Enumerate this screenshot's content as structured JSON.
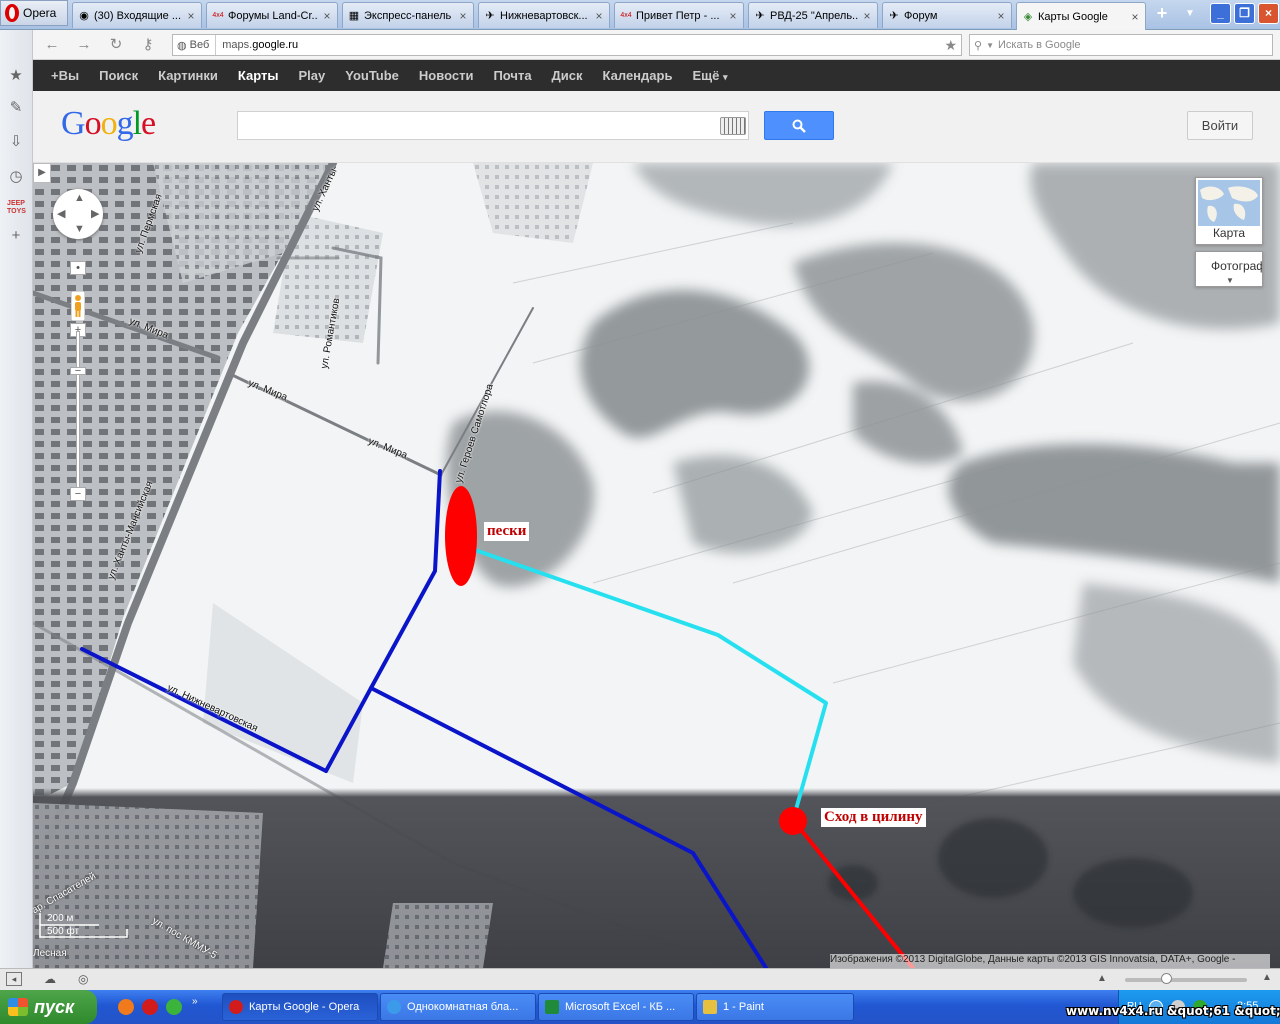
{
  "browser": {
    "menu_label": "Opera",
    "tabs": [
      {
        "label": "(30) Входящие ...",
        "icon": "gmail-icon"
      },
      {
        "label": "Форумы Land-Cr...",
        "icon": "forum-icon"
      },
      {
        "label": "Экспресс-панель",
        "icon": "speed-dial-icon"
      },
      {
        "label": "Нижневартовск...",
        "icon": "forum-icon"
      },
      {
        "label": "Привет Петр - ...",
        "icon": "forum-icon"
      },
      {
        "label": "РВД-25 \"Апрель...",
        "icon": "forum-icon"
      },
      {
        "label": "Форум",
        "icon": "forum-icon"
      },
      {
        "label": "Карты Google",
        "icon": "maps-icon"
      }
    ],
    "active_tab": 7,
    "address": {
      "scheme_label": "Веб",
      "url_prefix": "maps.",
      "url_domain": "google.ru"
    },
    "search_placeholder": "Искать в Google"
  },
  "google_bar": {
    "items": [
      "+Вы",
      "Поиск",
      "Картинки",
      "Карты",
      "Play",
      "YouTube",
      "Новости",
      "Почта",
      "Диск",
      "Календарь",
      "Ещё"
    ],
    "selected": "Карты",
    "more_caret": "▾"
  },
  "google_header": {
    "logo_letters": [
      {
        "ch": "G",
        "color": "#3369e8"
      },
      {
        "ch": "o",
        "color": "#d50f25"
      },
      {
        "ch": "o",
        "color": "#eeb211"
      },
      {
        "ch": "g",
        "color": "#3369e8"
      },
      {
        "ch": "l",
        "color": "#009925"
      },
      {
        "ch": "e",
        "color": "#d50f25"
      }
    ],
    "search_value": "",
    "signin_label": "Войти"
  },
  "map": {
    "map_type_label": "Карта",
    "satellite_label": "Фотограф",
    "road_labels": {
      "permskaya": "ул. Пермская",
      "mira_1": "ул. Мира",
      "mira_2": "ул. Мира",
      "mira_3": "ул. Мира",
      "romantikov": "ул. Романтиков",
      "hanty_top": "ул. Ханты-",
      "geroev": "ул. Героев Самотлора",
      "hanty_mansiyskaya": "ул. Ханты-Мансийская",
      "nizhnevartovskaya": "ул. Нижневартовская",
      "spasatelei": "ар. Спасателей",
      "kmmu": "ул. пос КММУ-5",
      "lesnaya": "Лесная"
    },
    "annotations": {
      "sands": "пески",
      "descent": "Сход в цилину"
    },
    "scale": {
      "metric": "200 м",
      "imperial": "500 фт"
    },
    "attribution": "Изображения ©2013 DigitalGlobe, Данные карты ©2013 GIS Innovatsia, DATA+, Google -",
    "colors": {
      "route_dark": "#0a14c8",
      "route_cyan": "#26e0f0",
      "marker_red": "#ff0000"
    }
  },
  "taskbar": {
    "start_label": "пуск",
    "windows": [
      {
        "label": "Карты Google - Opera",
        "active": true
      },
      {
        "label": "Однокомнатная бла...",
        "active": false
      },
      {
        "label": "Microsoft Excel - КБ ...",
        "active": false
      },
      {
        "label": "1 - Paint",
        "active": false
      }
    ],
    "tray_lang": "RU",
    "clock": "2:55"
  },
  "watermark": "www.nv4x4.ru &quot;61 &quot;"
}
